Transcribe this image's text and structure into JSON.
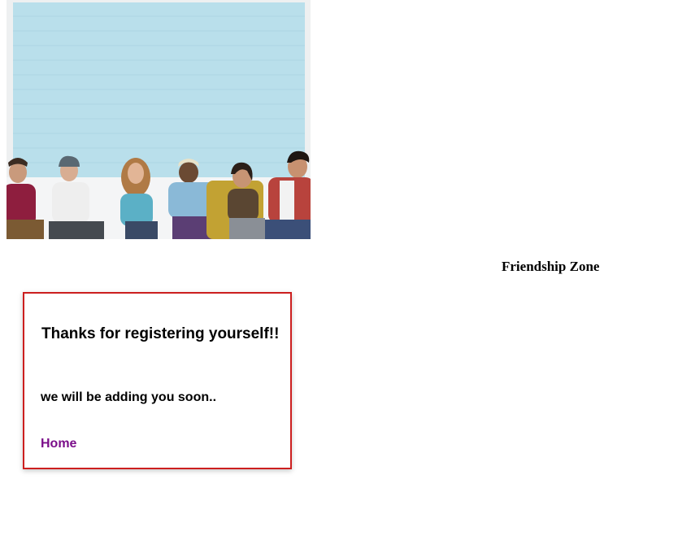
{
  "site": {
    "title": "Friendship Zone"
  },
  "hero": {
    "image_subject": "group of six friends sitting in front of a light-blue brick wall"
  },
  "card": {
    "heading": "Thanks for registering yourself!!",
    "message": "we will be adding you soon..",
    "home_link_label": "Home"
  },
  "colors": {
    "card_border": "#cc1f1f",
    "link_visited": "#7b0f8a",
    "wall_blue": "#b9dfeb"
  }
}
